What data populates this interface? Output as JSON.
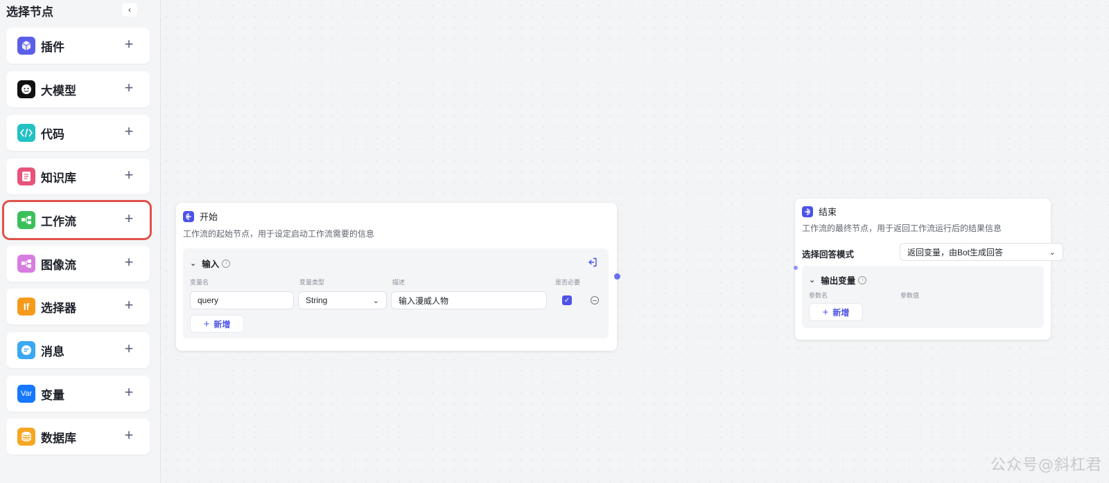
{
  "sidebar": {
    "title": "选择节点",
    "collapse_icon": "‹",
    "items": [
      {
        "label": "插件",
        "icon": "cube-icon",
        "color": "#5b5fe8",
        "glyph": "⬢"
      },
      {
        "label": "大模型",
        "icon": "llm-icon",
        "color": "#111111",
        "glyph": "☻"
      },
      {
        "label": "代码",
        "icon": "code-icon",
        "color": "#22c1c3",
        "glyph": "</>"
      },
      {
        "label": "知识库",
        "icon": "knowledge-icon",
        "color": "#e8537a",
        "glyph": "▤"
      },
      {
        "label": "工作流",
        "icon": "workflow-icon",
        "color": "#3bbf5a",
        "glyph": "⊞"
      },
      {
        "label": "图像流",
        "icon": "imageflow-icon",
        "color": "#d87de0",
        "glyph": "⊞"
      },
      {
        "label": "选择器",
        "icon": "selector-icon",
        "color": "#f59a1b",
        "glyph": "If"
      },
      {
        "label": "消息",
        "icon": "message-icon",
        "color": "#3aa8f5",
        "glyph": "≡"
      },
      {
        "label": "变量",
        "icon": "variable-icon",
        "color": "#1677ff",
        "glyph": "Var"
      },
      {
        "label": "数据库",
        "icon": "database-icon",
        "color": "#f5a623",
        "glyph": "≋"
      }
    ],
    "highlight_color": "#e0524a"
  },
  "start_node": {
    "title": "开始",
    "desc": "工作流的起始节点，用于设定启动工作流需要的信息",
    "input_section": "输入",
    "columns": {
      "name": "变量名",
      "type": "变量类型",
      "desc": "描述",
      "required": "是否必要"
    },
    "row": {
      "name": "query",
      "type": "String",
      "desc": "输入漫威人物",
      "required": true
    },
    "add_label": "新增"
  },
  "end_node": {
    "title": "结束",
    "desc": "工作流的最终节点，用于返回工作流运行后的结果信息",
    "mode_label": "选择回答模式",
    "mode_value": "返回变量，由Bot生成回答",
    "output_section": "输出变量",
    "columns": {
      "name": "参数名",
      "value": "参数值"
    },
    "add_label": "新增"
  },
  "accent_color": "#4d53e8",
  "watermark": "公众号@斜杠君"
}
